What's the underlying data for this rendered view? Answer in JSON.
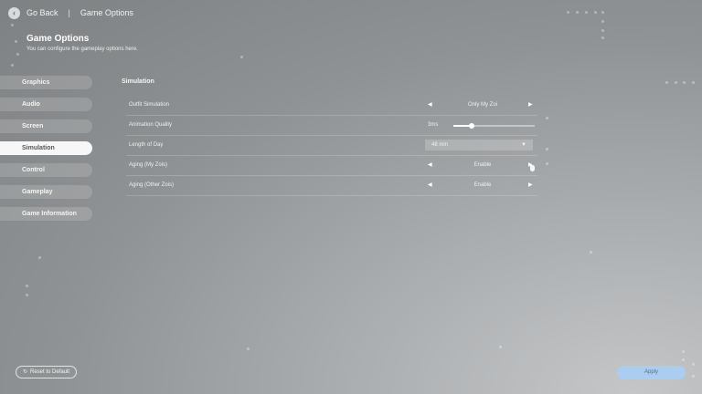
{
  "topbar": {
    "back_label": "Go Back",
    "separator": "|",
    "page_label": "Game Options",
    "back_icon": "chevron-left-icon"
  },
  "header": {
    "title": "Game Options",
    "subtitle": "You can configure the gameplay options here."
  },
  "menu": {
    "items": [
      {
        "label": "Graphics"
      },
      {
        "label": "Audio"
      },
      {
        "label": "Screen"
      },
      {
        "label": "Simulation"
      },
      {
        "label": "Control"
      },
      {
        "label": "Gameplay"
      },
      {
        "label": "Game Information"
      }
    ],
    "active": "Simulation"
  },
  "section": {
    "title": "Simulation"
  },
  "settings": {
    "outfit_simulation": {
      "label": "Outfit Simulation",
      "value": "Only My Zoi"
    },
    "animation_quality": {
      "label": "Animation Quality",
      "value": "3ms",
      "level": 0.23
    },
    "length_of_day": {
      "label": "Length of Day",
      "value": "48 min"
    },
    "aging_my_zois": {
      "label": "Aging (My Zois)",
      "value": "Enable"
    },
    "aging_other_zois": {
      "label": "Aging (Other Zois)",
      "value": "Enable"
    }
  },
  "arrows": {
    "left": "◀",
    "right": "▶",
    "caret": "▼"
  },
  "footer": {
    "reset_label": "Reset to Default",
    "apply_label": "Apply",
    "reset_icon": "reset-icon"
  },
  "colors": {
    "apply_button": "#aacdf0",
    "active_menu": "#f7f7f7"
  }
}
